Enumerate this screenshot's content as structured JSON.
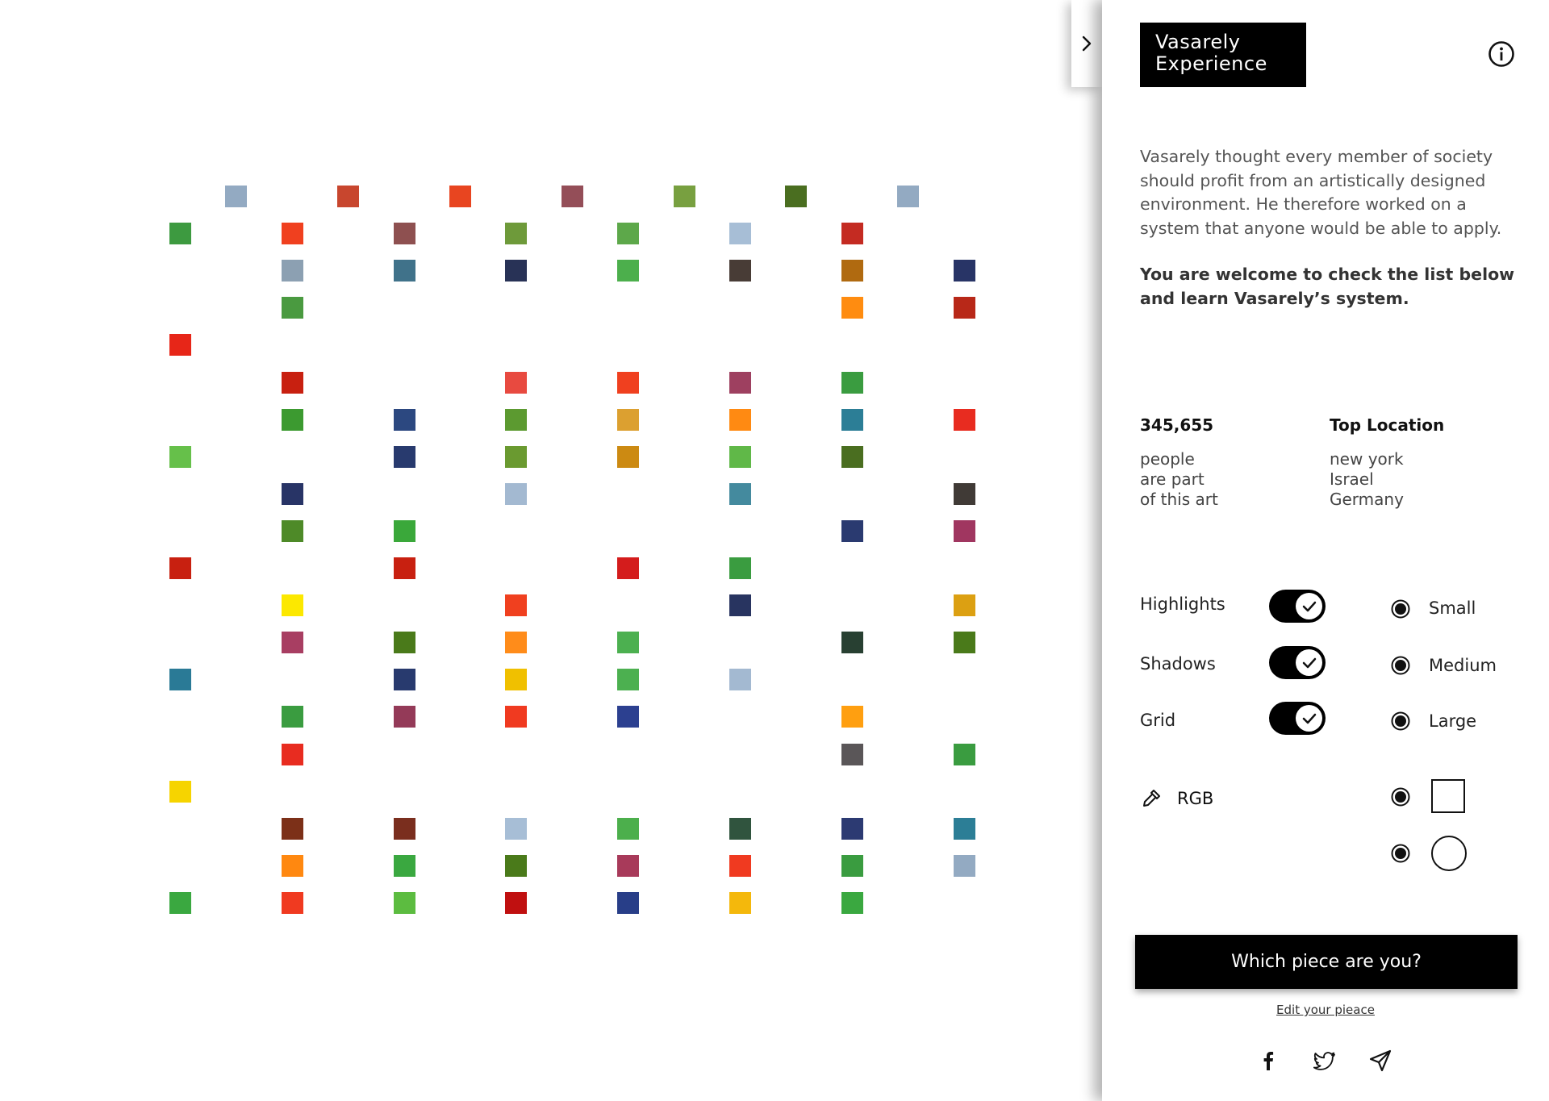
{
  "brand": {
    "line1": "Vasarely",
    "line2": "Experience"
  },
  "intro": {
    "p1": "Vasarely thought every member of society should profit from an artistically designed environment. He therefore worked on a system that anyone would be able to apply.",
    "p2": "You are welcome to check the list below and learn Vasarely’s system."
  },
  "stats": {
    "count": "345,655",
    "count_caption": [
      "people",
      "are part",
      "of this art"
    ],
    "top_location_label": "Top Location",
    "locations": [
      "new york",
      "Israel",
      "Germany"
    ]
  },
  "options": {
    "toggles": [
      {
        "label": "Highlights",
        "on": true
      },
      {
        "label": "Shadows",
        "on": true
      },
      {
        "label": "Grid",
        "on": true
      }
    ],
    "sizes": [
      {
        "label": "Small",
        "selected": true
      },
      {
        "label": "Medium",
        "selected": true
      },
      {
        "label": "Large",
        "selected": true
      }
    ],
    "color_mode_label": "RGB",
    "shapes": [
      "square",
      "circle"
    ]
  },
  "cta": {
    "label": "Which piece are you?",
    "edit_link": "Edit your pieace"
  },
  "icons": {
    "collapse": "chevron-right-icon",
    "info": "info-icon",
    "picker": "eyedropper-icon",
    "social": [
      "facebook-icon",
      "twitter-icon",
      "send-icon"
    ]
  },
  "artwork": {
    "rows": [
      [
        "",
        "#93aac2",
        "",
        "#c8462e",
        "",
        "#e84520",
        "",
        "#944e58",
        "",
        "#78a040",
        "",
        "#4a6e20",
        "",
        "#93aac2"
      ],
      [
        "#3d9a40",
        "#f0401f",
        "#8e5050",
        "#6e9a3a",
        "#5da84a",
        "#a7bed6",
        "#c42b22",
        ""
      ],
      [
        "",
        "#8ca0b2",
        "#40728a",
        "#283256",
        "#4caf4c",
        "#483c36",
        "#b06a10",
        "#283466"
      ],
      [
        "",
        "#4a9a40",
        "",
        "",
        "",
        "",
        "#ff8c10",
        "#b82818"
      ],
      [
        "#e72618",
        "",
        "",
        "",
        "",
        "",
        "",
        ""
      ],
      [
        "",
        "#c82010",
        "",
        "#e84a40",
        "#f0401f",
        "#9e4060",
        "#3a9c40",
        ""
      ],
      [
        "",
        "#3c9a30",
        "#2c4880",
        "#5c9a30",
        "#dca030",
        "#ff8a12",
        "#2c7e96",
        "#e82c20"
      ],
      [
        "#66c04a",
        "",
        "#283a6e",
        "#6a9a30",
        "#cc8a12",
        "#60b848",
        "#4a6e20",
        ""
      ],
      [
        "",
        "#283466",
        "",
        "#a3b9d1",
        "",
        "#448a9e",
        "",
        "#403a36"
      ],
      [
        "",
        "#4e8a28",
        "#3aa83a",
        "",
        "",
        "",
        "#2a3a70",
        "#a03660"
      ],
      [
        "#c82010",
        "",
        "#c82010",
        "",
        "#d41c1c",
        "#3a9c40",
        "",
        ""
      ],
      [
        "",
        "#fce800",
        "",
        "#f0401f",
        "",
        "#283460",
        "",
        "#dca012"
      ],
      [
        "",
        "#a83e62",
        "#4a7a1a",
        "#ff8c1a",
        "#4cb050",
        "",
        "#284032",
        "#4a7a1a"
      ],
      [
        "#2a7a96",
        "",
        "#283a6e",
        "#f0c000",
        "#4cb050",
        "#a3b9d1",
        "",
        ""
      ],
      [
        "",
        "#3a9c40",
        "#943a58",
        "#f03a20",
        "#2c4090",
        "",
        "#ff9f10",
        ""
      ],
      [
        "",
        "#e82c20",
        "",
        "",
        "",
        "",
        "#5a5658",
        "#3a9c40"
      ],
      [
        "#f6d400",
        "",
        "",
        "",
        "",
        "",
        "",
        ""
      ],
      [
        "",
        "#7c3018",
        "#7a2e1e",
        "#a7bed6",
        "#4caf4c",
        "#30543e",
        "#2c3a72",
        "#2c7e96"
      ],
      [
        "",
        "#ff8810",
        "#3aa840",
        "#4a7a1a",
        "#a83a5a",
        "#f03a20",
        "#3a9c40",
        "#93aac2"
      ],
      [
        "#3aa840",
        "#f03a20",
        "#5cbc40",
        "#c01010",
        "#283e88",
        "#f4b80c",
        "#3aa840",
        ""
      ]
    ]
  }
}
